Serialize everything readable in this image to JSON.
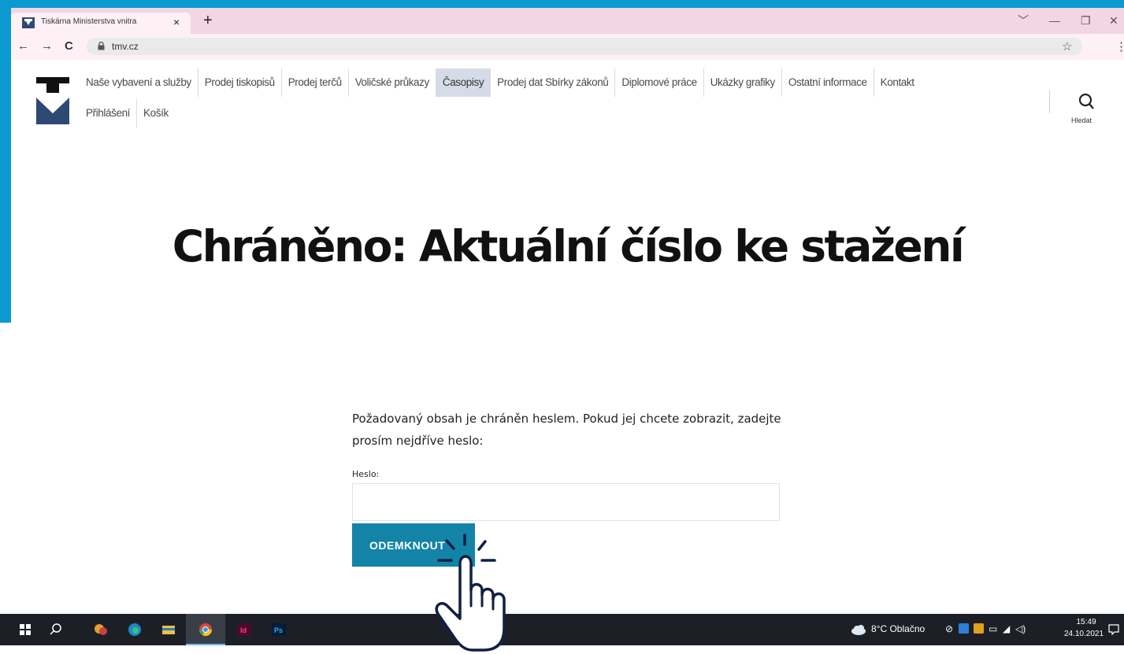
{
  "browser": {
    "tab_title": "Tiskárna Ministerstva vnitra",
    "tab_close": "×",
    "new_tab": "+",
    "url": "tmv.cz",
    "window_controls": [
      "﹀",
      "—",
      "❐",
      "✕"
    ],
    "nav": {
      "back": "←",
      "forward": "→",
      "reload": "C"
    }
  },
  "site": {
    "menu_row1": [
      "Naše vybavení a služby",
      "Prodej tiskopisů",
      "Prodej terčů",
      "Voličské průkazy",
      "Časopisy",
      "Prodej dat Sbírky zákonů",
      "Diplomové práce",
      "Ukázky grafiky",
      "Ostatní informace",
      "Kontakt"
    ],
    "menu_row2": [
      "Přihlášení",
      "Košík"
    ],
    "active_item": "Časopisy",
    "search_label": "Hledat"
  },
  "page": {
    "title": "Chráněno: Aktuální číslo ke stažení",
    "info_text": "Požadovaný obsah je chráněn heslem. Pokud jej chcete zobrazit, zadejte prosím nejdříve heslo:",
    "password_label": "Heslo:",
    "password_value": "",
    "unlock_button": "ODEMKNOUT"
  },
  "taskbar": {
    "weather": "8°C Oblačno",
    "time": "15:49",
    "date": "24.10.2021"
  },
  "colors": {
    "frame_blue": "#0a9ad0",
    "tab_bar_pink": "#f2d6e3",
    "button_blue": "#1384a8",
    "active_menu_bg": "#d5dbe8",
    "logo_navy": "#2f4a72",
    "taskbar": "#1c2026"
  }
}
